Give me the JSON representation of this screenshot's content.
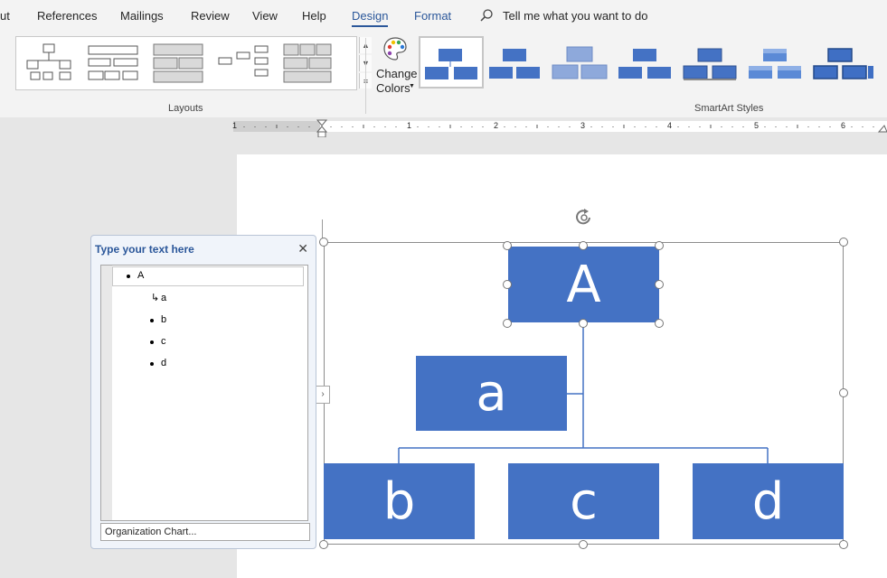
{
  "tabs": [
    {
      "label": "ut"
    },
    {
      "label": "References"
    },
    {
      "label": "Mailings"
    },
    {
      "label": "Review"
    },
    {
      "label": "View"
    },
    {
      "label": "Help"
    },
    {
      "label": "Design"
    },
    {
      "label": "Format"
    }
  ],
  "tell_me": {
    "placeholder": "Tell me what you want to do"
  },
  "ribbon": {
    "layouts_label": "Layouts",
    "change_colors_line1": "Change",
    "change_colors_line2": "Colors",
    "smartart_styles_label": "SmartArt Styles"
  },
  "ruler": {
    "numbers": [
      "1",
      "1",
      "2",
      "3",
      "4",
      "5",
      "6"
    ]
  },
  "text_pane": {
    "title": "Type your text here",
    "items": [
      {
        "text": "A",
        "level": 1
      },
      {
        "text": "a",
        "level": 2,
        "assistant": true
      },
      {
        "text": "b",
        "level": 2
      },
      {
        "text": "c",
        "level": 2
      },
      {
        "text": "d",
        "level": 2
      }
    ],
    "footer_link": "Organization Chart..."
  },
  "smartart": {
    "nodes": {
      "top": "A",
      "assistant": "a",
      "child1": "b",
      "child2": "c",
      "child3": "d"
    },
    "fill_color": "#4472c4"
  },
  "colors": {
    "accent": "#2b579a",
    "node_fill": "#4472c4"
  }
}
